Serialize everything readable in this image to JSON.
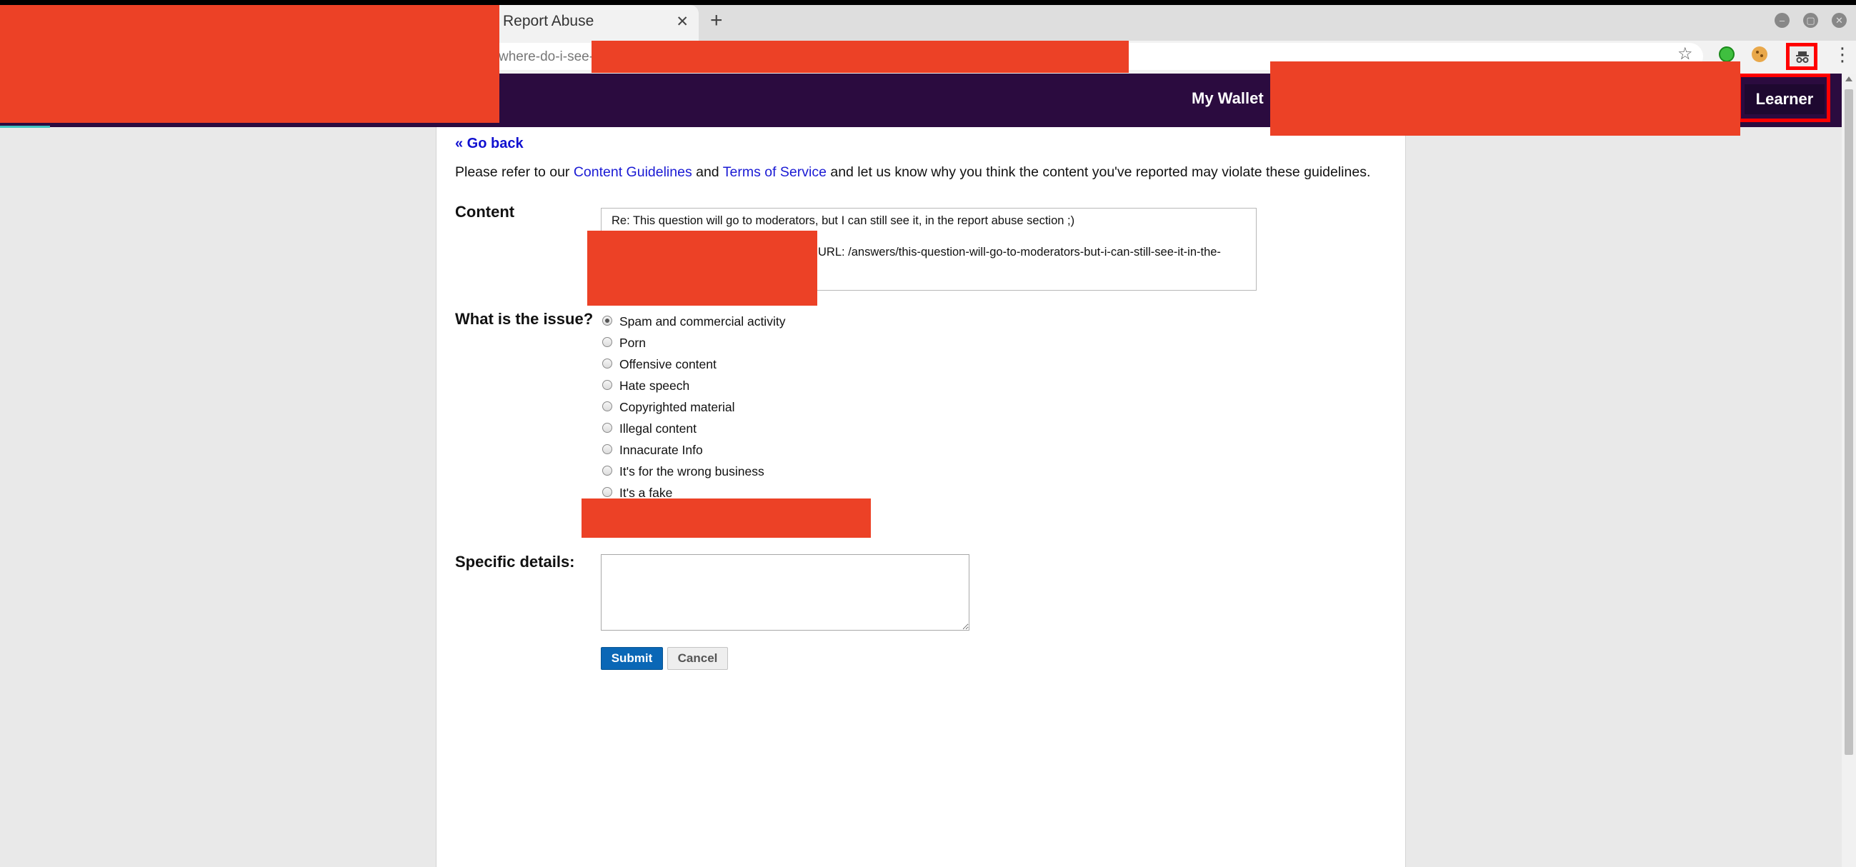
{
  "browser": {
    "tab_title": "Report Abuse",
    "tab_close": "✕",
    "new_tab": "+",
    "url_visible": "where-do-i-see-",
    "star": "☆",
    "menu": "⋮",
    "window_buttons": {
      "minimize": "–",
      "maximize": "▢",
      "close": "✕"
    }
  },
  "header": {
    "wallet_label": "My Wallet",
    "learner_label": "Learner"
  },
  "page": {
    "go_back": "« Go back",
    "intro": {
      "before": "Please refer to our ",
      "guidelines_link": "Content Guidelines",
      "and": " and ",
      "tos_link": "Terms of Service",
      "after": " and let us know why you think the content you've reported may violate these guidelines."
    },
    "content_label": "Content",
    "content_line1": "Re: This question will go to moderators, but I can still see it, in the report abuse section ;)",
    "content_line2": "URL: /answers/this-question-will-go-to-moderators-but-i-can-still-see-it-in-the-",
    "issue_label": "What is the issue?",
    "issue_options": [
      {
        "label": "Spam and commercial activity",
        "checked": true
      },
      {
        "label": "Porn",
        "checked": false
      },
      {
        "label": "Offensive content",
        "checked": false
      },
      {
        "label": "Hate speech",
        "checked": false
      },
      {
        "label": "Copyrighted material",
        "checked": false
      },
      {
        "label": "Illegal content",
        "checked": false
      },
      {
        "label": "Innacurate Info",
        "checked": false
      },
      {
        "label": "It's for the wrong business",
        "checked": false
      },
      {
        "label": "It's a fake",
        "checked": false
      }
    ],
    "details_label": "Specific details:",
    "details_value": "",
    "submit_label": "Submit",
    "cancel_label": "Cancel"
  },
  "colors": {
    "header_bg": "#2b0b3f",
    "link": "#1a1ad4",
    "submit_bg": "#0a67b6",
    "redaction": "#ec4126",
    "highlight_outline": "#ff0000"
  }
}
